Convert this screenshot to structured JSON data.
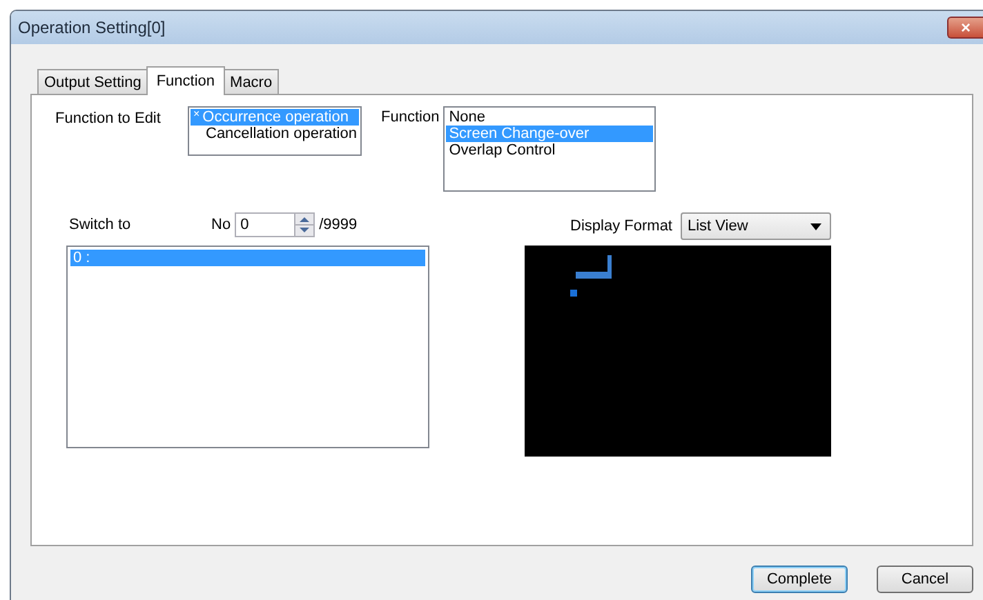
{
  "window": {
    "title": "Operation Setting[0]",
    "close": "×"
  },
  "tabs": [
    {
      "label": "Output Setting",
      "selected": false
    },
    {
      "label": "Function",
      "selected": true
    },
    {
      "label": "Macro",
      "selected": false
    }
  ],
  "function_to_edit": {
    "label": "Function to Edit",
    "items": [
      {
        "mark": "×",
        "label": "Occurrence operation",
        "selected": true
      },
      {
        "label": "Cancellation operation",
        "selected": false
      }
    ]
  },
  "function": {
    "label": "Function",
    "items": [
      {
        "label": "None",
        "selected": false
      },
      {
        "label": "Screen Change-over",
        "selected": true
      },
      {
        "label": "Overlap Control",
        "selected": false
      }
    ]
  },
  "switch_to": {
    "label": "Switch to",
    "no_label": "No",
    "no_value": "0",
    "max": "/9999",
    "items": [
      {
        "label": "0 :",
        "selected": true
      }
    ]
  },
  "display_format": {
    "label": "Display Format",
    "value": "List View"
  },
  "buttons": [
    {
      "label": "Complete",
      "default": true
    },
    {
      "label": "Cancel",
      "default": false
    }
  ]
}
